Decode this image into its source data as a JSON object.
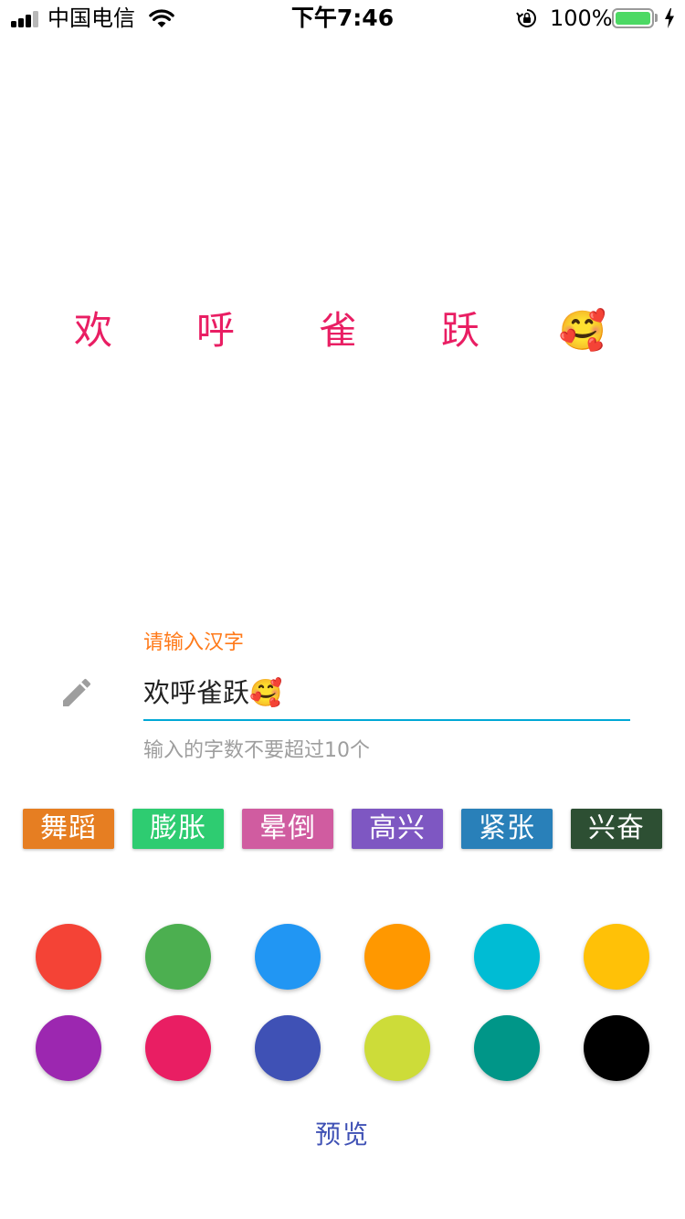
{
  "status_bar": {
    "carrier": "中国电信",
    "time": "下午7:46",
    "battery": "100%",
    "battery_level": 1.0,
    "signal_bars": 3,
    "icons": [
      "signal-icon",
      "wifi-icon",
      "rotation-lock-icon",
      "battery-icon",
      "charging-bolt-icon"
    ]
  },
  "preview": {
    "chars": [
      "欢",
      "呼",
      "雀",
      "跃",
      "🥰"
    ],
    "color": "#e91e63"
  },
  "text_field": {
    "label": "请输入汉字",
    "value": "欢呼雀跃🥰",
    "helper": "输入的字数不要超过10个",
    "label_color": "#ff7a1a",
    "underline_color": "#00a8d6",
    "icon": "pencil-icon"
  },
  "effects": [
    {
      "label": "舞蹈",
      "color": "#e67e22"
    },
    {
      "label": "膨胀",
      "color": "#2ecc71"
    },
    {
      "label": "晕倒",
      "color": "#d05ca0"
    },
    {
      "label": "高兴",
      "color": "#7e57c2"
    },
    {
      "label": "紧张",
      "color": "#2980b9"
    },
    {
      "label": "兴奋",
      "color": "#2d4f33"
    }
  ],
  "colors": [
    {
      "name": "red",
      "hex": "#f44336"
    },
    {
      "name": "green",
      "hex": "#4caf50"
    },
    {
      "name": "blue",
      "hex": "#2196f3"
    },
    {
      "name": "orange",
      "hex": "#ff9800"
    },
    {
      "name": "cyan",
      "hex": "#00bcd4"
    },
    {
      "name": "amber",
      "hex": "#ffc107"
    },
    {
      "name": "purple",
      "hex": "#9c27b0"
    },
    {
      "name": "pink",
      "hex": "#e91e63"
    },
    {
      "name": "indigo",
      "hex": "#3f51b5"
    },
    {
      "name": "lime",
      "hex": "#cddc39"
    },
    {
      "name": "teal",
      "hex": "#009688"
    },
    {
      "name": "black",
      "hex": "#000000"
    }
  ],
  "preview_button": {
    "label": "预览",
    "color": "#3f51b5"
  }
}
